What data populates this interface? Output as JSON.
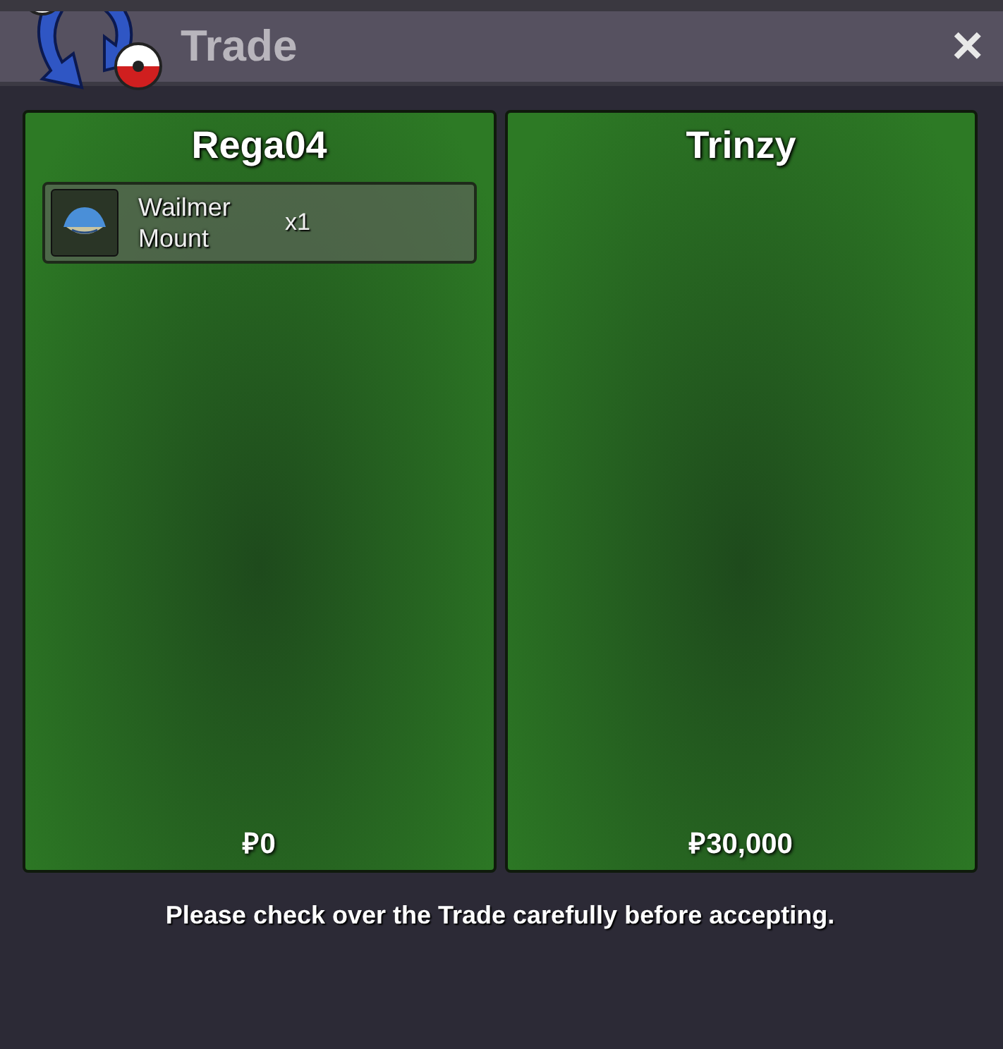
{
  "window": {
    "title": "Trade",
    "close": "×"
  },
  "panels": [
    {
      "player": "Rega04",
      "items": [
        {
          "name": "Wailmer Mount",
          "quantity": "x1"
        }
      ],
      "money": "₽0"
    },
    {
      "player": "Trinzy",
      "money": "₽30,000"
    }
  ],
  "notice": "Please check over the Trade carefully before accepting."
}
